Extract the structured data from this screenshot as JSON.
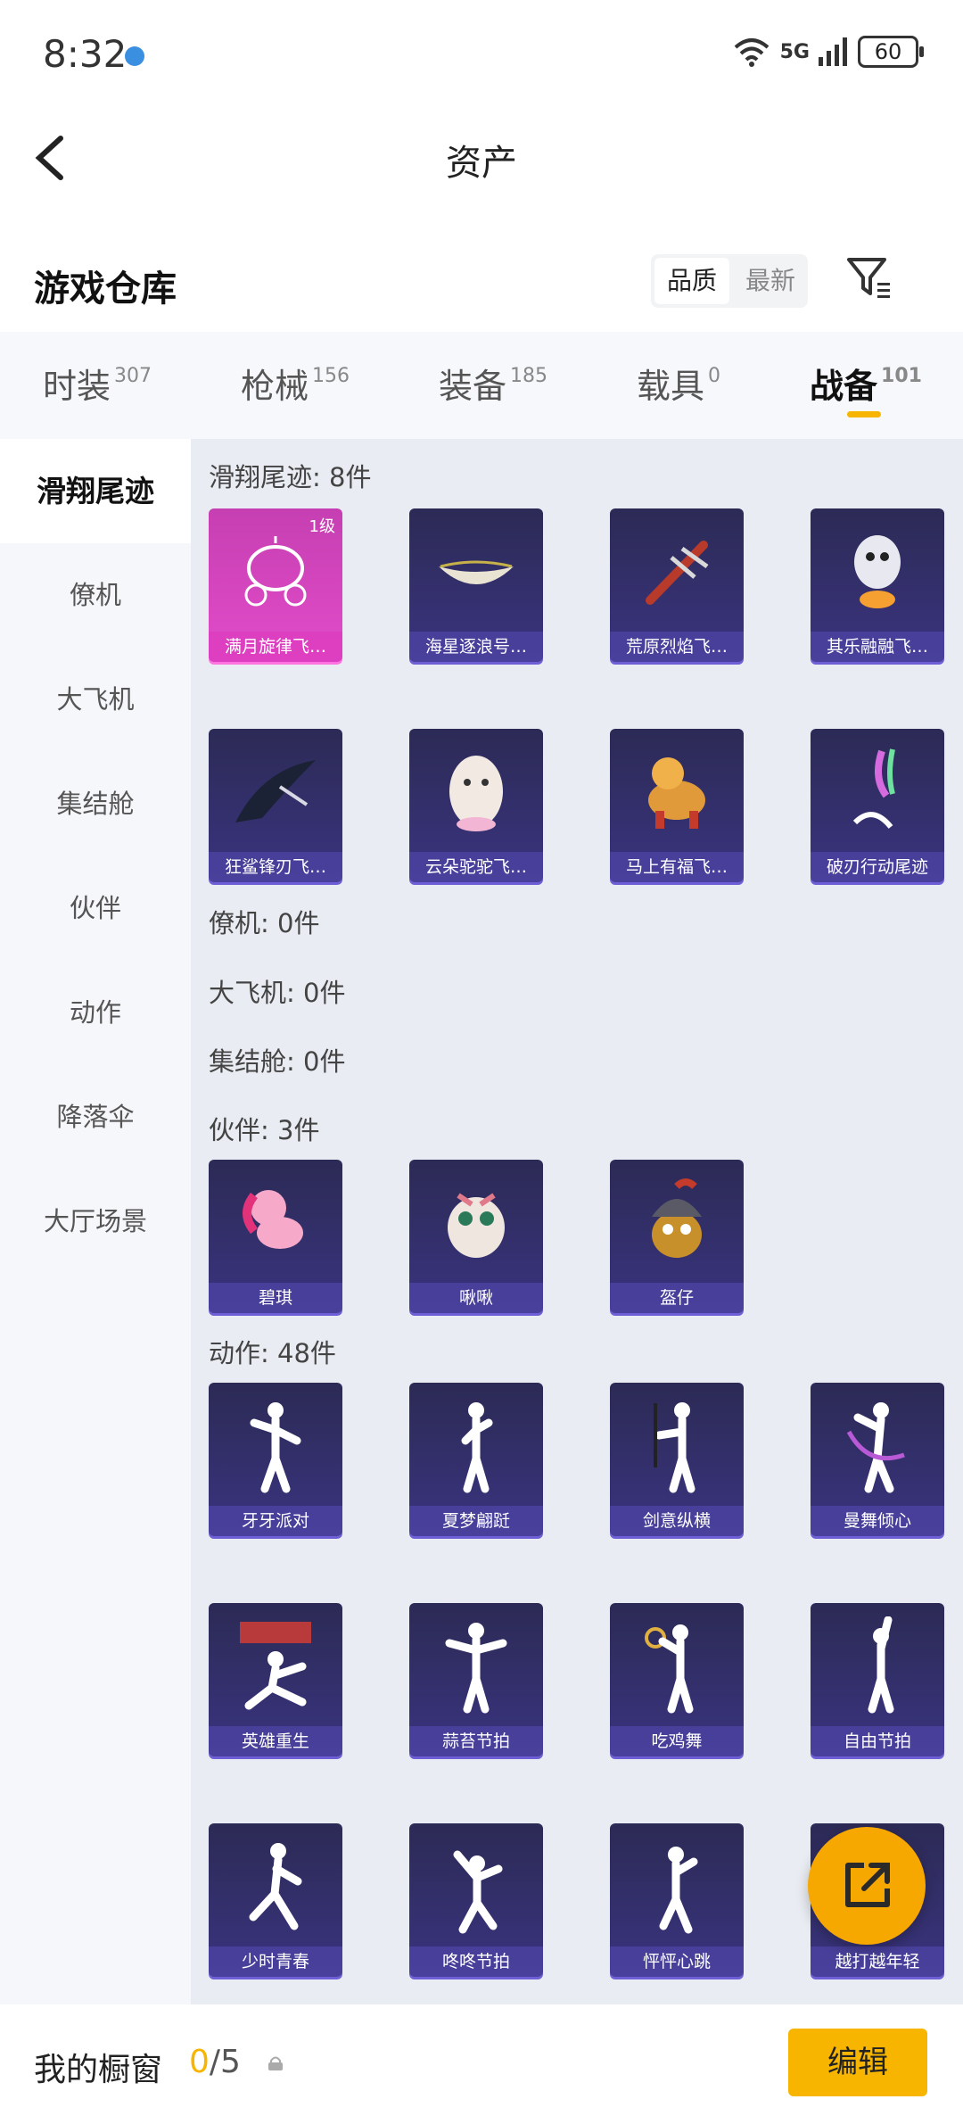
{
  "status": {
    "time": "8:32",
    "network": "5G",
    "battery": "60"
  },
  "header": {
    "title": "资产"
  },
  "warehouse": {
    "title": "游戏仓库",
    "sort_quality": "品质",
    "sort_newest": "最新"
  },
  "tabs": [
    {
      "label": "时装",
      "count": "307"
    },
    {
      "label": "枪械",
      "count": "156"
    },
    {
      "label": "装备",
      "count": "185"
    },
    {
      "label": "载具",
      "count": "0"
    },
    {
      "label": "战备",
      "count": "101"
    }
  ],
  "sidebar": [
    "滑翔尾迹",
    "僚机",
    "大飞机",
    "集结舱",
    "伙伴",
    "动作",
    "降落伞",
    "大厅场景"
  ],
  "sections": {
    "glide": {
      "label": "滑翔尾迹: 8件",
      "level": "1级",
      "items": [
        "满月旋律飞…",
        "海星逐浪号…",
        "荒原烈焰飞…",
        "其乐融融飞…",
        "狂鲨锋刃飞…",
        "云朵驼驼飞…",
        "马上有福飞…",
        "破刃行动尾迹"
      ]
    },
    "wingman": {
      "label": "僚机: 0件"
    },
    "bigplane": {
      "label": "大飞机: 0件"
    },
    "pod": {
      "label": "集结舱: 0件"
    },
    "partner": {
      "label": "伙伴: 3件",
      "items": [
        "碧琪",
        "啾啾",
        "盔仔"
      ]
    },
    "emote": {
      "label": "动作: 48件",
      "items": [
        "牙牙派对",
        "夏梦翩跹",
        "剑意纵横",
        "曼舞倾心",
        "英雄重生",
        "蒜苔节拍",
        "吃鸡舞",
        "自由节拍",
        "少时青春",
        "咚咚节拍",
        "怦怦心跳",
        "越打越年轻"
      ]
    }
  },
  "showcase": {
    "label": "我的橱窗",
    "current": "0",
    "total": "/5",
    "edit": "编辑"
  },
  "colors": {
    "accent": "#f7b500",
    "card_bg": "#2c2a55",
    "card_highlight": "#e24cc9"
  }
}
